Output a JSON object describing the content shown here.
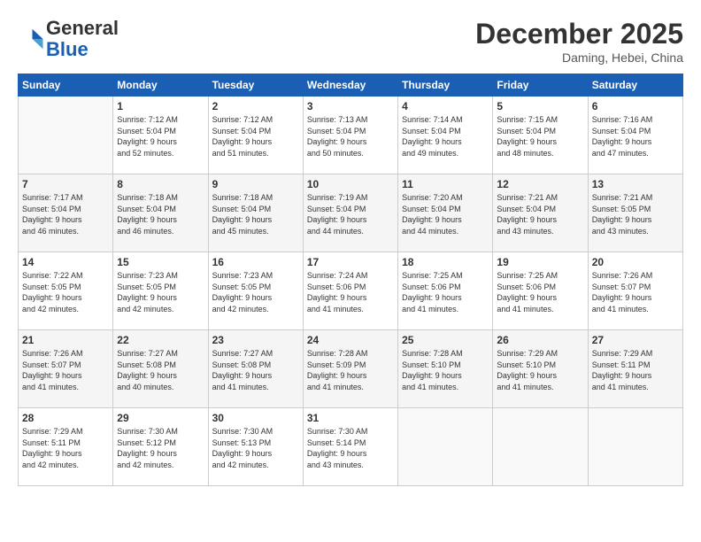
{
  "header": {
    "logo_line1": "General",
    "logo_line2": "Blue",
    "month": "December 2025",
    "location": "Daming, Hebei, China"
  },
  "days_of_week": [
    "Sunday",
    "Monday",
    "Tuesday",
    "Wednesday",
    "Thursday",
    "Friday",
    "Saturday"
  ],
  "weeks": [
    [
      {
        "day": "",
        "info": ""
      },
      {
        "day": "1",
        "info": "Sunrise: 7:12 AM\nSunset: 5:04 PM\nDaylight: 9 hours\nand 52 minutes."
      },
      {
        "day": "2",
        "info": "Sunrise: 7:12 AM\nSunset: 5:04 PM\nDaylight: 9 hours\nand 51 minutes."
      },
      {
        "day": "3",
        "info": "Sunrise: 7:13 AM\nSunset: 5:04 PM\nDaylight: 9 hours\nand 50 minutes."
      },
      {
        "day": "4",
        "info": "Sunrise: 7:14 AM\nSunset: 5:04 PM\nDaylight: 9 hours\nand 49 minutes."
      },
      {
        "day": "5",
        "info": "Sunrise: 7:15 AM\nSunset: 5:04 PM\nDaylight: 9 hours\nand 48 minutes."
      },
      {
        "day": "6",
        "info": "Sunrise: 7:16 AM\nSunset: 5:04 PM\nDaylight: 9 hours\nand 47 minutes."
      }
    ],
    [
      {
        "day": "7",
        "info": "Sunrise: 7:17 AM\nSunset: 5:04 PM\nDaylight: 9 hours\nand 46 minutes."
      },
      {
        "day": "8",
        "info": "Sunrise: 7:18 AM\nSunset: 5:04 PM\nDaylight: 9 hours\nand 46 minutes."
      },
      {
        "day": "9",
        "info": "Sunrise: 7:18 AM\nSunset: 5:04 PM\nDaylight: 9 hours\nand 45 minutes."
      },
      {
        "day": "10",
        "info": "Sunrise: 7:19 AM\nSunset: 5:04 PM\nDaylight: 9 hours\nand 44 minutes."
      },
      {
        "day": "11",
        "info": "Sunrise: 7:20 AM\nSunset: 5:04 PM\nDaylight: 9 hours\nand 44 minutes."
      },
      {
        "day": "12",
        "info": "Sunrise: 7:21 AM\nSunset: 5:04 PM\nDaylight: 9 hours\nand 43 minutes."
      },
      {
        "day": "13",
        "info": "Sunrise: 7:21 AM\nSunset: 5:05 PM\nDaylight: 9 hours\nand 43 minutes."
      }
    ],
    [
      {
        "day": "14",
        "info": "Sunrise: 7:22 AM\nSunset: 5:05 PM\nDaylight: 9 hours\nand 42 minutes."
      },
      {
        "day": "15",
        "info": "Sunrise: 7:23 AM\nSunset: 5:05 PM\nDaylight: 9 hours\nand 42 minutes."
      },
      {
        "day": "16",
        "info": "Sunrise: 7:23 AM\nSunset: 5:05 PM\nDaylight: 9 hours\nand 42 minutes."
      },
      {
        "day": "17",
        "info": "Sunrise: 7:24 AM\nSunset: 5:06 PM\nDaylight: 9 hours\nand 41 minutes."
      },
      {
        "day": "18",
        "info": "Sunrise: 7:25 AM\nSunset: 5:06 PM\nDaylight: 9 hours\nand 41 minutes."
      },
      {
        "day": "19",
        "info": "Sunrise: 7:25 AM\nSunset: 5:06 PM\nDaylight: 9 hours\nand 41 minutes."
      },
      {
        "day": "20",
        "info": "Sunrise: 7:26 AM\nSunset: 5:07 PM\nDaylight: 9 hours\nand 41 minutes."
      }
    ],
    [
      {
        "day": "21",
        "info": "Sunrise: 7:26 AM\nSunset: 5:07 PM\nDaylight: 9 hours\nand 41 minutes."
      },
      {
        "day": "22",
        "info": "Sunrise: 7:27 AM\nSunset: 5:08 PM\nDaylight: 9 hours\nand 40 minutes."
      },
      {
        "day": "23",
        "info": "Sunrise: 7:27 AM\nSunset: 5:08 PM\nDaylight: 9 hours\nand 41 minutes."
      },
      {
        "day": "24",
        "info": "Sunrise: 7:28 AM\nSunset: 5:09 PM\nDaylight: 9 hours\nand 41 minutes."
      },
      {
        "day": "25",
        "info": "Sunrise: 7:28 AM\nSunset: 5:10 PM\nDaylight: 9 hours\nand 41 minutes."
      },
      {
        "day": "26",
        "info": "Sunrise: 7:29 AM\nSunset: 5:10 PM\nDaylight: 9 hours\nand 41 minutes."
      },
      {
        "day": "27",
        "info": "Sunrise: 7:29 AM\nSunset: 5:11 PM\nDaylight: 9 hours\nand 41 minutes."
      }
    ],
    [
      {
        "day": "28",
        "info": "Sunrise: 7:29 AM\nSunset: 5:11 PM\nDaylight: 9 hours\nand 42 minutes."
      },
      {
        "day": "29",
        "info": "Sunrise: 7:30 AM\nSunset: 5:12 PM\nDaylight: 9 hours\nand 42 minutes."
      },
      {
        "day": "30",
        "info": "Sunrise: 7:30 AM\nSunset: 5:13 PM\nDaylight: 9 hours\nand 42 minutes."
      },
      {
        "day": "31",
        "info": "Sunrise: 7:30 AM\nSunset: 5:14 PM\nDaylight: 9 hours\nand 43 minutes."
      },
      {
        "day": "",
        "info": ""
      },
      {
        "day": "",
        "info": ""
      },
      {
        "day": "",
        "info": ""
      }
    ]
  ]
}
